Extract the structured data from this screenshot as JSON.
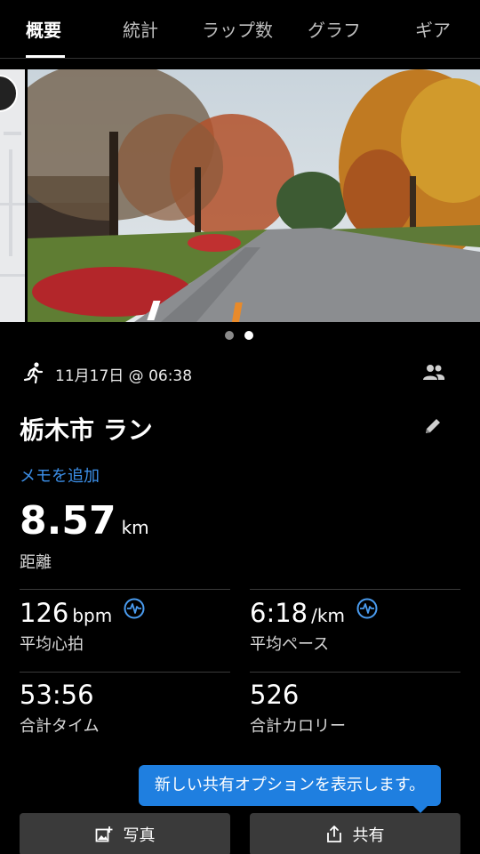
{
  "tabs": [
    {
      "label": "概要",
      "active": true
    },
    {
      "label": "統計"
    },
    {
      "label": "ラップ数"
    },
    {
      "label": "グラフ"
    },
    {
      "label": "ギア"
    }
  ],
  "carousel": {
    "pages": 2,
    "current_page": 2
  },
  "activity": {
    "date": "11月17日 @ 06:38",
    "title": "栃木市 ラン",
    "memo_link": "メモを追加",
    "distance": {
      "value": "8.57",
      "unit": "km",
      "label": "距離"
    }
  },
  "stats": [
    {
      "value": "126",
      "unit": "bpm",
      "label": "平均心拍",
      "hr_icon": true
    },
    {
      "value": "6:18",
      "unit": "/km",
      "label": "平均ペース",
      "hr_icon": true
    },
    {
      "value": "53:56",
      "unit": "",
      "label": "合計タイム",
      "hr_icon": false
    },
    {
      "value": "526",
      "unit": "",
      "label": "合計カロリー",
      "hr_icon": false
    }
  ],
  "tooltip": {
    "text": "新しい共有オプションを表示します。"
  },
  "buttons": {
    "photo": "写真",
    "share": "共有"
  },
  "colors": {
    "accent": "#3c8fe8",
    "tooltip": "#1f7fe0",
    "button_bg": "#3a3a3a",
    "background": "#000000"
  }
}
